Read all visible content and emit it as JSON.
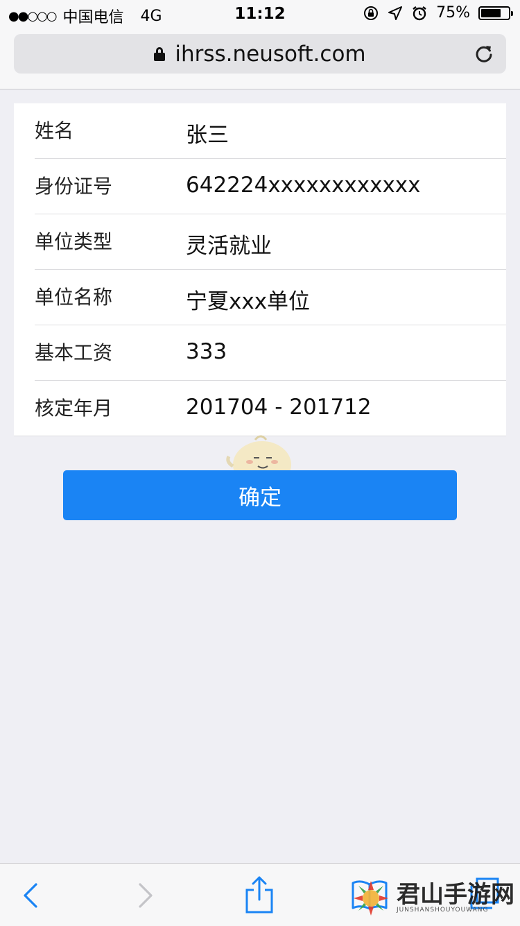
{
  "status_bar": {
    "signal": "●●○○○",
    "carrier": "中国电信",
    "network": "4G",
    "time": "11:12",
    "battery_percent": "75%",
    "battery_level": 0.75
  },
  "browser": {
    "url": "ihrss.neusoft.com"
  },
  "form": {
    "rows": [
      {
        "label": "姓名",
        "value": "张三"
      },
      {
        "label": "身份证号",
        "value": "642224xxxxxxxxxxxx"
      },
      {
        "label": "单位类型",
        "value": "灵活就业"
      },
      {
        "label": "单位名称",
        "value": "宁夏xxx单位"
      },
      {
        "label": "基本工资",
        "value": "333"
      },
      {
        "label": "核定年月",
        "value": "201704 - 201712"
      }
    ]
  },
  "actions": {
    "confirm_label": "确定"
  },
  "watermark": {
    "title": "君山手游网",
    "subtitle": "JUNSHANSHOUYOUWANG"
  },
  "colors": {
    "accent": "#1a84f4",
    "background": "#efeff4",
    "toolbar_icon": "#1a84f4",
    "disabled_icon": "#c4c4c8"
  }
}
